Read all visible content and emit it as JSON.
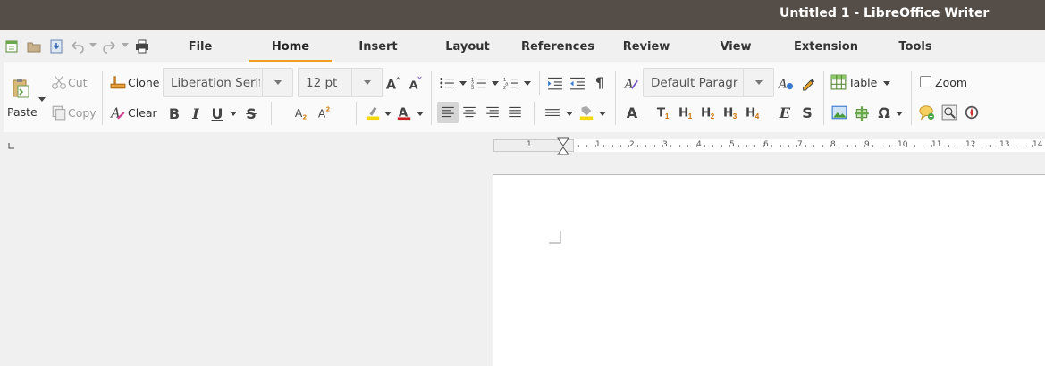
{
  "window": {
    "title": "Untitled 1 - LibreOffice Writer"
  },
  "quick_access": [
    {
      "name": "new-document-icon"
    },
    {
      "name": "open-folder-icon"
    },
    {
      "name": "save-icon"
    },
    {
      "name": "undo-icon"
    },
    {
      "name": "redo-icon"
    },
    {
      "name": "print-icon"
    }
  ],
  "tabs": [
    {
      "label": "File",
      "active": false
    },
    {
      "label": "Home",
      "active": true
    },
    {
      "label": "Insert",
      "active": false
    },
    {
      "label": "Layout",
      "active": false
    },
    {
      "label": "References",
      "active": false
    },
    {
      "label": "Review",
      "active": false
    },
    {
      "label": "View",
      "active": false
    },
    {
      "label": "Extension",
      "active": false
    },
    {
      "label": "Tools",
      "active": false
    }
  ],
  "ribbon": {
    "paste_label": "Paste",
    "cut_label": "Cut",
    "copy_label": "Copy",
    "clone_label": "Clone",
    "clear_label": "Clear",
    "font_name": "Liberation Serif",
    "font_size": "12 pt",
    "paragraph_style": "Default Paragraph Style",
    "table_label": "Table",
    "zoom_label": "Zoom"
  },
  "ruler": {
    "numbers": [
      "1",
      "1",
      "2",
      "3",
      "4",
      "5",
      "6",
      "7",
      "8",
      "9",
      "10",
      "11",
      "12",
      "13",
      "14"
    ]
  },
  "colors": {
    "titlebar": "#554e48",
    "accent_underline": "#f0a020",
    "highlight_yellow": "#f5d90a",
    "font_color_red": "#cc2222"
  }
}
